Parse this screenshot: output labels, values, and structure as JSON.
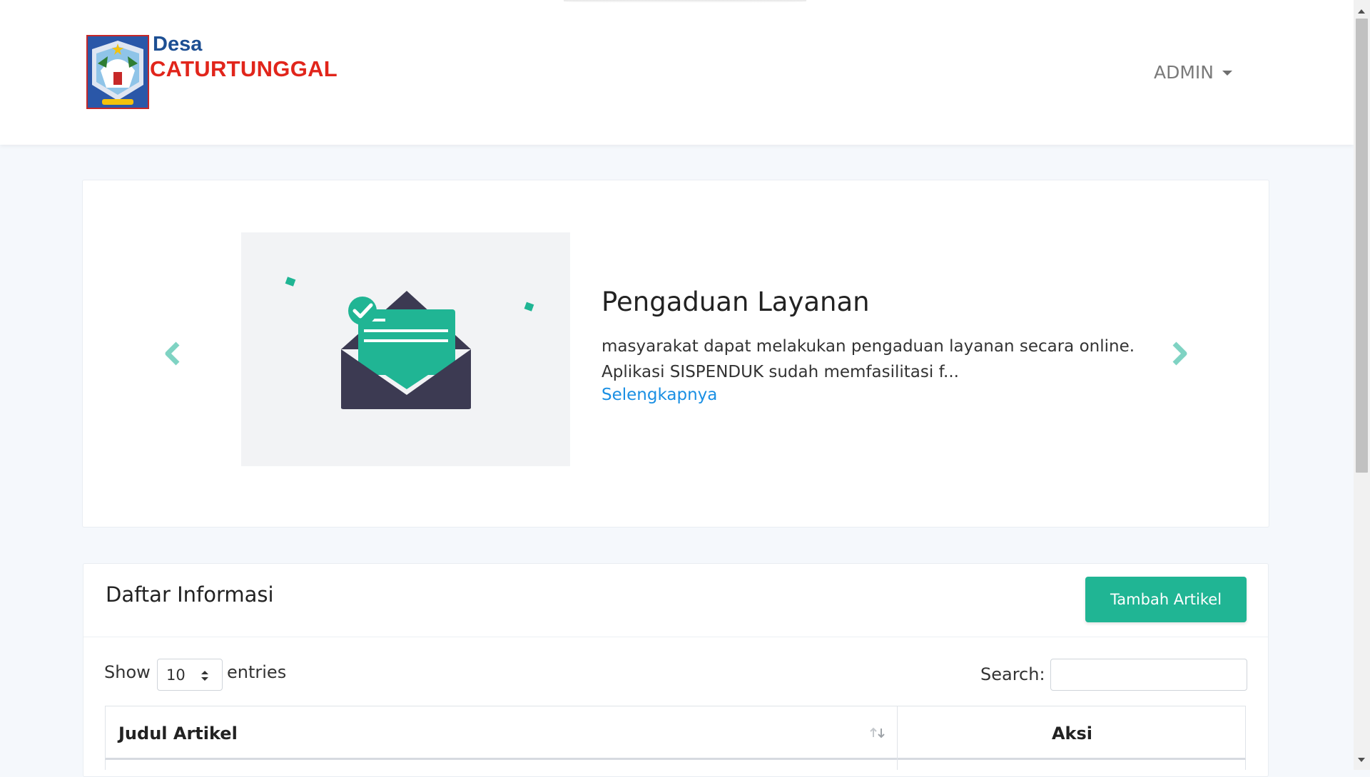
{
  "header": {
    "logo_line1": "Desa",
    "logo_line2": "CATURTUNGGAL",
    "user_menu_label": "ADMIN"
  },
  "carousel": {
    "slide_title": "Pengaduan Layanan",
    "slide_description": "masyarakat dapat melakukan pengaduan layanan secara online. Aplikasi SISPENDUK sudah memfasilitasi f...",
    "read_more_label": "Selengkapnya",
    "prev_icon": "chevron-left-icon",
    "next_icon": "chevron-right-icon"
  },
  "list": {
    "title": "Daftar Informasi",
    "add_button_label": "Tambah Artikel",
    "show_label": "Show",
    "entries_value": "10",
    "entries_label": "entries",
    "search_label": "Search:",
    "search_value": "",
    "columns": [
      "Judul Artikel",
      "Aksi"
    ]
  },
  "colors": {
    "brand_blue": "#1d4f93",
    "brand_red": "#e1251b",
    "accent_green": "#20b594",
    "link_blue": "#1a8fe3"
  }
}
